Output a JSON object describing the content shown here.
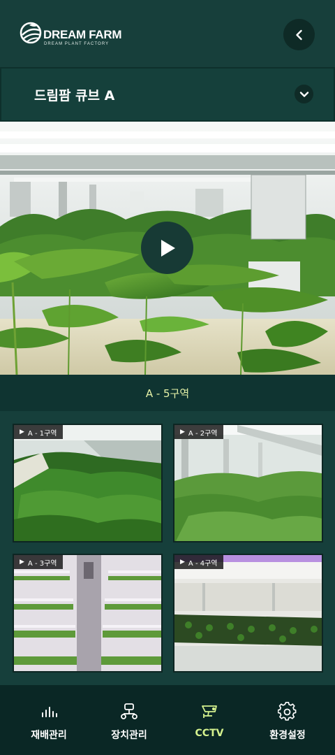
{
  "brand": {
    "title": "DREAM FARM",
    "subtitle": "DREAM PLANT FACTORY"
  },
  "selector": {
    "value": "드림팜 큐브 A"
  },
  "main_camera": {
    "zone_label": "A - 5구역"
  },
  "cameras": [
    {
      "label": "A - 1구역"
    },
    {
      "label": "A - 2구역"
    },
    {
      "label": "A - 3구역"
    },
    {
      "label": "A - 4구역"
    }
  ],
  "nav": {
    "items": [
      {
        "label": "재배관리",
        "icon": "bar-chart-icon",
        "active": false
      },
      {
        "label": "장치관리",
        "icon": "device-network-icon",
        "active": false
      },
      {
        "label": "CCTV",
        "icon": "cctv-camera-icon",
        "active": true
      },
      {
        "label": "환경설정",
        "icon": "gear-icon",
        "active": false
      }
    ]
  },
  "colors": {
    "background": "#12393a",
    "accent": "#d5f28e",
    "nav_background": "#0a2725"
  }
}
